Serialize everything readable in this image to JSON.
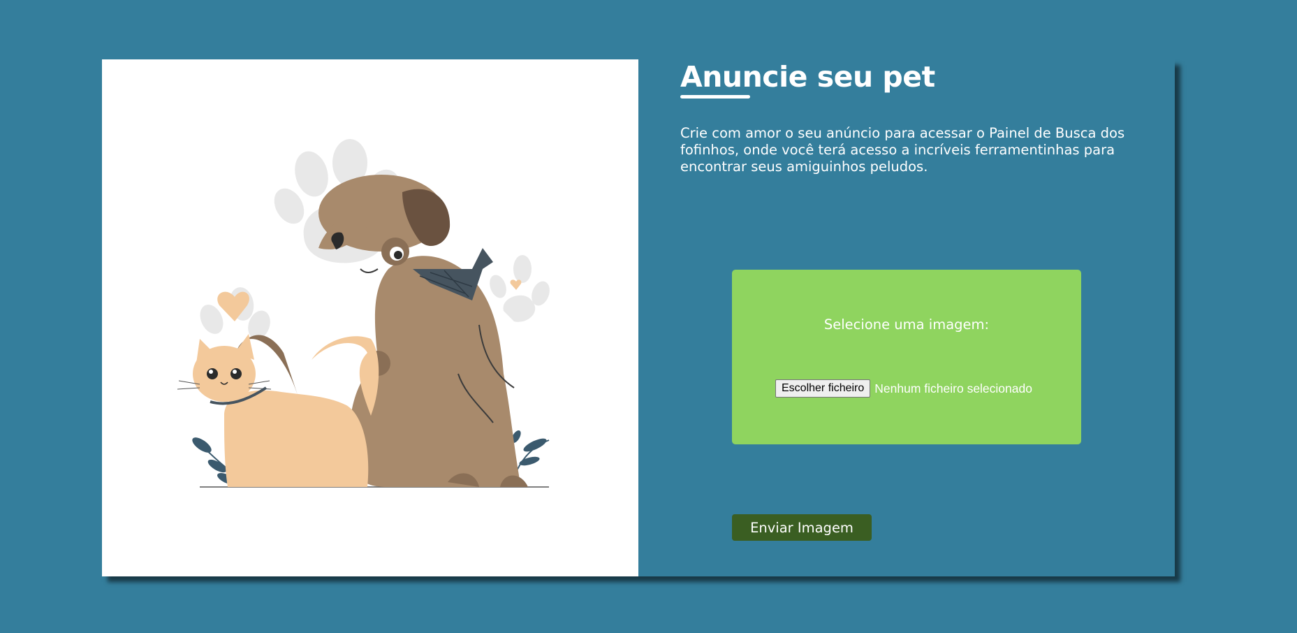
{
  "header": {
    "title": "Anuncie seu pet"
  },
  "main": {
    "description": "Crie com amor o seu anúncio para acessar o Painel de Busca dos fofinhos, onde você terá acesso a incríveis ferramentinhas para encontrar seus amiguinhos peludos."
  },
  "upload": {
    "label": "Selecione uma imagem:",
    "file_button": "Escolher ficheiro",
    "file_status": "Nenhum ficheiro selecionado"
  },
  "actions": {
    "submit_label": "Enviar Imagem"
  },
  "illustration": {
    "icon": "cat-and-dog-illustration"
  },
  "colors": {
    "background": "#347e9c",
    "upload_box": "#8fd45f",
    "submit_button": "#3a5e22",
    "dog": "#a88a6c",
    "cat": "#f3c99b",
    "paw": "#e8e8e8"
  }
}
